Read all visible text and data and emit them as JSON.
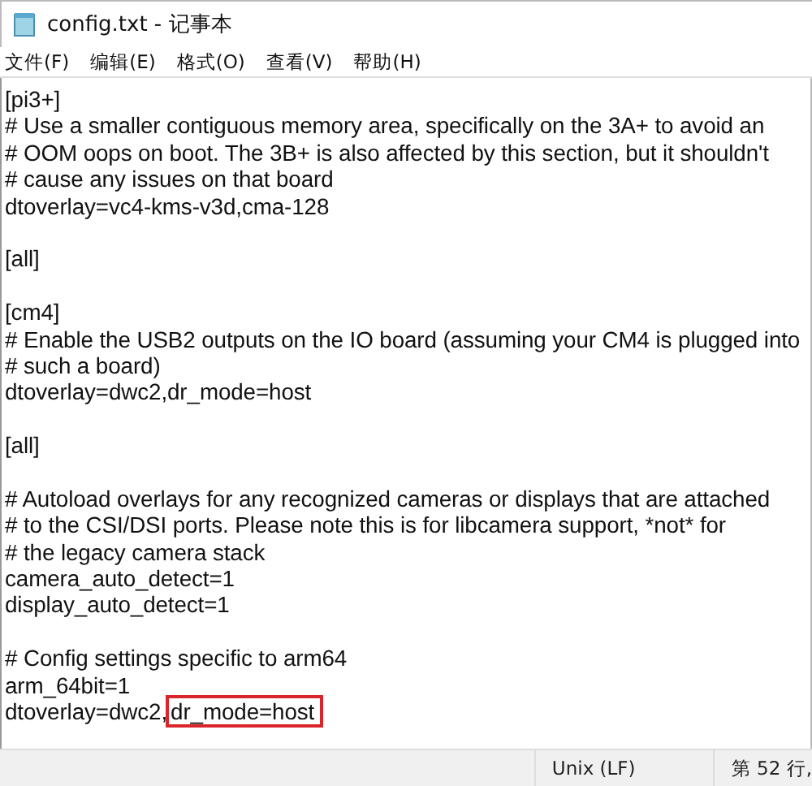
{
  "window": {
    "title": "config.txt - 记事本"
  },
  "menu": [
    "文件(F)",
    "编辑(E)",
    "格式(O)",
    "查看(V)",
    "帮助(H)"
  ],
  "lines": [
    {
      "kind": "text",
      "text": "[pi3+]"
    },
    {
      "kind": "text",
      "text": "# Use a smaller contiguous memory area, specifically on the 3A+ to avoid an"
    },
    {
      "kind": "text",
      "text": "# OOM oops on boot. The 3B+ is also affected by this section, but it shouldn't"
    },
    {
      "kind": "text",
      "text": "# cause any issues on that board"
    },
    {
      "kind": "text",
      "text": "dtoverlay=vc4-kms-v3d,cma-128"
    },
    {
      "kind": "blank"
    },
    {
      "kind": "text",
      "text": "[all]"
    },
    {
      "kind": "blank"
    },
    {
      "kind": "text",
      "text": "[cm4]"
    },
    {
      "kind": "text",
      "text": "# Enable the USB2 outputs on the IO board (assuming your CM4 is plugged into"
    },
    {
      "kind": "text",
      "text": "# such a board)"
    },
    {
      "kind": "text",
      "text": "dtoverlay=dwc2,dr_mode=host"
    },
    {
      "kind": "blank"
    },
    {
      "kind": "text",
      "text": "[all]"
    },
    {
      "kind": "blank"
    },
    {
      "kind": "text",
      "text": "# Autoload overlays for any recognized cameras or displays that are attached"
    },
    {
      "kind": "text",
      "text": "# to the CSI/DSI ports. Please note this is for libcamera support, *not* for"
    },
    {
      "kind": "text",
      "text": "# the legacy camera stack"
    },
    {
      "kind": "text",
      "text": "camera_auto_detect=1"
    },
    {
      "kind": "text",
      "text": "display_auto_detect=1"
    },
    {
      "kind": "blank"
    },
    {
      "kind": "text",
      "text": "# Config settings specific to arm64"
    },
    {
      "kind": "text",
      "text": "arm_64bit=1"
    },
    {
      "kind": "text",
      "text": "dtoverlay=dwc2,",
      "boxed": "dr_mode=host"
    }
  ],
  "status_bar": {
    "line_ending": "Unix (LF)",
    "position": "第 52 行,"
  }
}
